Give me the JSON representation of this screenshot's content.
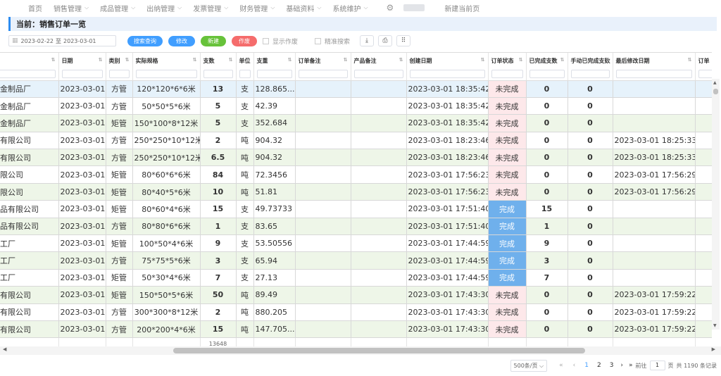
{
  "nav": {
    "home": "首页",
    "items": [
      "销售管理",
      "成品管理",
      "出纳管理",
      "发票管理",
      "财务管理",
      "基础资料",
      "系统维护"
    ],
    "new_tab": "新建当前页"
  },
  "page_title": "当前：销售订单一览",
  "toolbar": {
    "date_from": "2023-02-22",
    "date_sep": "至",
    "date_to": "2023-03-01",
    "search_label": "搜索查询",
    "edit_label": "修改",
    "new_label": "新建",
    "void_label": "作废",
    "show_void_label": "显示作废",
    "precise_search_label": "精准搜索",
    "colors": {
      "blue": "#409eff",
      "green": "#67c23a",
      "red": "#f56c6c"
    }
  },
  "table": {
    "headers": [
      "",
      "日期",
      "类别",
      "实际规格",
      "支数",
      "单位",
      "支重",
      "订单备注",
      "产品备注",
      "创建日期",
      "订单状态",
      "已完成支数",
      "手动已完成支数",
      "最后修改日期",
      "订单"
    ],
    "rows": [
      [
        "五金制品厂",
        "2023-03-01",
        "方管",
        "120*120*6*6米",
        "13",
        "支",
        "128.865...",
        "",
        "",
        "2023-03-01 18:35:42",
        "未完成",
        "0",
        "0",
        ""
      ],
      [
        "五金制品厂",
        "2023-03-01",
        "方管",
        "50*50*5*6米",
        "5",
        "支",
        "42.39",
        "",
        "",
        "2023-03-01 18:35:42",
        "未完成",
        "0",
        "0",
        ""
      ],
      [
        "五金制品厂",
        "2023-03-01",
        "矩管",
        "150*100*8*12米",
        "5",
        "支",
        "352.684",
        "",
        "",
        "2023-03-01 18:35:42",
        "未完成",
        "0",
        "0",
        ""
      ],
      [
        "贸有限公司",
        "2023-03-01",
        "方管",
        "250*250*10*12米",
        "2",
        "吨",
        "904.32",
        "",
        "",
        "2023-03-01 18:23:46",
        "未完成",
        "0",
        "0",
        "2023-03-01 18:25:33"
      ],
      [
        "贸有限公司",
        "2023-03-01",
        "方管",
        "250*250*10*12米",
        "6.5",
        "吨",
        "904.32",
        "",
        "",
        "2023-03-01 18:23:46",
        "未完成",
        "0",
        "0",
        "2023-03-01 18:25:33"
      ],
      [
        "有限公司",
        "2023-03-01",
        "矩管",
        "80*60*6*6米",
        "84",
        "吨",
        "72.3456",
        "",
        "",
        "2023-03-01 17:56:23",
        "未完成",
        "0",
        "0",
        "2023-03-01 17:56:29"
      ],
      [
        "有限公司",
        "2023-03-01",
        "矩管",
        "80*40*5*6米",
        "10",
        "吨",
        "51.81",
        "",
        "",
        "2023-03-01 17:56:23",
        "未完成",
        "0",
        "0",
        "2023-03-01 17:56:29"
      ],
      [
        "制品有限公司",
        "2023-03-01",
        "矩管",
        "80*60*4*6米",
        "15",
        "支",
        "49.73733",
        "",
        "",
        "2023-03-01 17:51:40",
        "完成",
        "15",
        "0",
        ""
      ],
      [
        "制品有限公司",
        "2023-03-01",
        "方管",
        "80*80*6*6米",
        "1",
        "支",
        "83.65",
        "",
        "",
        "2023-03-01 17:51:40",
        "完成",
        "1",
        "0",
        ""
      ],
      [
        "加工厂",
        "2023-03-01",
        "矩管",
        "100*50*4*6米",
        "9",
        "支",
        "53.50556",
        "",
        "",
        "2023-03-01 17:44:59",
        "完成",
        "9",
        "0",
        ""
      ],
      [
        "加工厂",
        "2023-03-01",
        "方管",
        "75*75*5*6米",
        "3",
        "支",
        "65.94",
        "",
        "",
        "2023-03-01 17:44:59",
        "完成",
        "3",
        "0",
        ""
      ],
      [
        "加工厂",
        "2023-03-01",
        "矩管",
        "50*30*4*6米",
        "7",
        "支",
        "27.13",
        "",
        "",
        "2023-03-01 17:44:59",
        "完成",
        "7",
        "0",
        ""
      ],
      [
        "造有限公司",
        "2023-03-01",
        "矩管",
        "150*50*5*6米",
        "50",
        "吨",
        "89.49",
        "",
        "",
        "2023-03-01 17:43:30",
        "未完成",
        "0",
        "0",
        "2023-03-01 17:59:22"
      ],
      [
        "造有限公司",
        "2023-03-01",
        "方管",
        "300*300*8*12米",
        "2",
        "吨",
        "880.205",
        "",
        "",
        "2023-03-01 17:43:30",
        "未完成",
        "0",
        "0",
        "2023-03-01 17:59:22"
      ],
      [
        "造有限公司",
        "2023-03-01",
        "方管",
        "200*200*4*6米",
        "15",
        "吨",
        "147.705...",
        "",
        "",
        "2023-03-01 17:43:30",
        "未完成",
        "0",
        "0",
        "2023-03-01 17:59:22"
      ]
    ],
    "total_pieces": "13648",
    "status_done": "完成"
  },
  "pager": {
    "page_size": "500条/页",
    "pages": [
      "1",
      "2",
      "3"
    ],
    "current_page": "1",
    "goto_label": "前往",
    "goto_value": "1",
    "page_unit": "页",
    "total_text": "共 1190 条记录"
  }
}
